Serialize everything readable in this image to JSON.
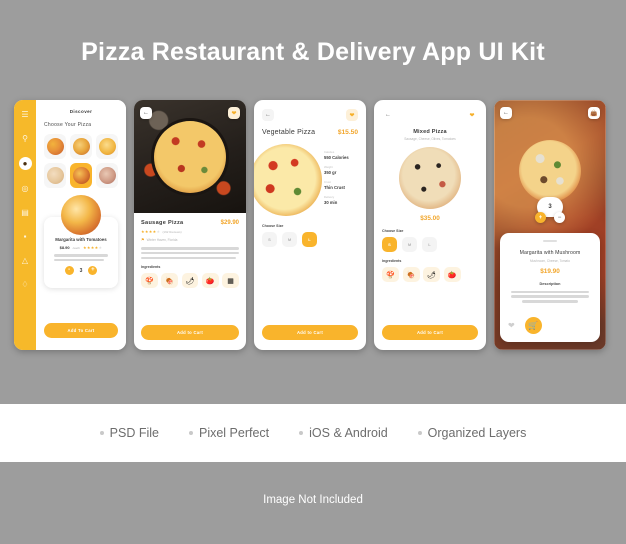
{
  "header": {
    "title": "Pizza Restaurant & Delivery App UI Kit"
  },
  "colors": {
    "background": "#9d9d9d",
    "accent_yellow": "#f9b42c",
    "accent_orange": "#f2a62b",
    "card_white": "#ffffff",
    "muted_text": "#b5b5b5"
  },
  "screens": [
    {
      "id": "discover",
      "header": "Discover",
      "section_title": "Choose Your Pizza",
      "sidebar_icons": [
        "menu-icon",
        "search-icon",
        "pizza-icon",
        "hotdog-icon",
        "burger-icon",
        "sandwich-icon",
        "sushi-icon",
        "drink-icon"
      ],
      "grid": [
        {
          "name": "pizza-thumb-1",
          "selected": false
        },
        {
          "name": "pizza-thumb-2",
          "selected": false
        },
        {
          "name": "pizza-thumb-3",
          "selected": false
        },
        {
          "name": "pizza-thumb-4",
          "selected": false
        },
        {
          "name": "pizza-thumb-5",
          "selected": true
        },
        {
          "name": "pizza-thumb-6",
          "selected": false
        }
      ],
      "product": {
        "name": "Margarita with Tomatoes",
        "price": "$8.90",
        "price_unit": "/each",
        "rating": 4,
        "rating_max": 5,
        "description": "Quisque semper augue turpis, et interdum nulla pulvinar a mauris do.",
        "quantity": "3",
        "decrement_label": "-",
        "increment_label": "+"
      },
      "cta": "Add To Cart"
    },
    {
      "id": "sausage-detail",
      "back_icon": "back-arrow-icon",
      "favorite_icon": "heart-icon",
      "product": {
        "name": "Sausage Pizza",
        "price": "$29.90",
        "rating": 4,
        "rating_max": 5,
        "reviews": "(192 Reviews)",
        "location": "Winter Haven, Florida",
        "description": "Fusce felis felis, ultricies eu porttitor at, facilisis a diam. Phasellus volutpat felis ultricies, malesuada odio quis, feugiat lorem nunc nec condimentum."
      },
      "ingredients_title": "Ingredients",
      "ingredients": [
        "mushroom-icon",
        "meat-icon",
        "chili-icon",
        "tomato-icon",
        "cheese-icon"
      ],
      "cta": "Add to Cart"
    },
    {
      "id": "vegetable-detail",
      "back_icon": "back-arrow-icon",
      "favorite_icon": "heart-icon",
      "product": {
        "name": "Vegetable Pizza",
        "price": "$15.50"
      },
      "specs": [
        {
          "label": "Calories",
          "value": "550 Calories"
        },
        {
          "label": "Weight",
          "value": "350 gr"
        },
        {
          "label": "Crust",
          "value": "Thin Crust"
        },
        {
          "label": "Delivery",
          "value": "30 min"
        }
      ],
      "size_title": "Choose Size",
      "sizes": [
        {
          "label": "S",
          "selected": false
        },
        {
          "label": "M",
          "selected": false
        },
        {
          "label": "L",
          "selected": true
        }
      ],
      "cta": "Add to Cart"
    },
    {
      "id": "mixed-detail",
      "back_icon": "back-arrow-icon",
      "favorite_icon": "heart-icon",
      "product": {
        "name": "Mixed Pizza",
        "subtitle": "Sausage, Cheese, Olives, Tomatoes",
        "price": "$35.00"
      },
      "size_title": "Choose Size",
      "sizes": [
        {
          "label": "S",
          "selected": true
        },
        {
          "label": "M",
          "selected": false
        },
        {
          "label": "L",
          "selected": false
        }
      ],
      "ingredients_title": "Ingredients",
      "ingredients": [
        "mushroom-icon",
        "meat-icon",
        "chili-icon",
        "tomato-icon"
      ],
      "cta": "Add to Cart"
    },
    {
      "id": "margarita-sheet",
      "back_icon": "back-arrow-icon",
      "bag_icon": "shopping-bag-icon",
      "quantity": "3",
      "increment_label": "+",
      "decrement_label": "−",
      "product": {
        "name": "Margarita with Mushroom",
        "subtitle": "Mushroom, Cheese, Tomato",
        "price": "$19.90"
      },
      "description_title": "Description",
      "description": "Etiam blandit neque ac sem laoreet, a hendrerit lorem cursus. Vivamus tristique ipsum nisi, non pretium nulla sodales quis.",
      "favorite_icon": "heart-icon",
      "cart_icon": "cart-icon"
    }
  ],
  "features": [
    {
      "label": "PSD File"
    },
    {
      "label": "Pixel Perfect"
    },
    {
      "label": "iOS & Android"
    },
    {
      "label": "Organized Layers"
    }
  ],
  "footer": {
    "note": "Image Not Included"
  }
}
